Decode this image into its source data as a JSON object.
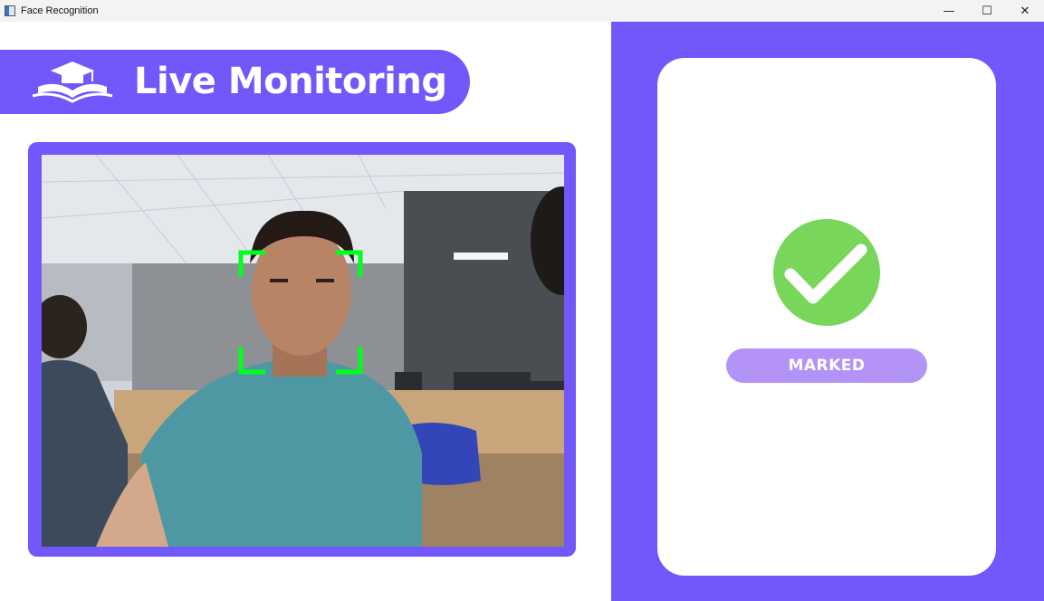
{
  "window": {
    "title": "Face Recognition",
    "controls": {
      "minimize": "—",
      "maximize": "☐",
      "close": "✕"
    }
  },
  "header": {
    "title": "Live Monitoring",
    "logo_icon": "graduation-cap-book-icon"
  },
  "camera": {
    "feed_description": "webcam-feed",
    "detection_box_color": "#00ff1a"
  },
  "status": {
    "label": "MARKED",
    "icon": "check-circle-icon",
    "icon_color": "#78d65a"
  },
  "colors": {
    "accent": "#7257fb",
    "badge": "#b393f5"
  }
}
